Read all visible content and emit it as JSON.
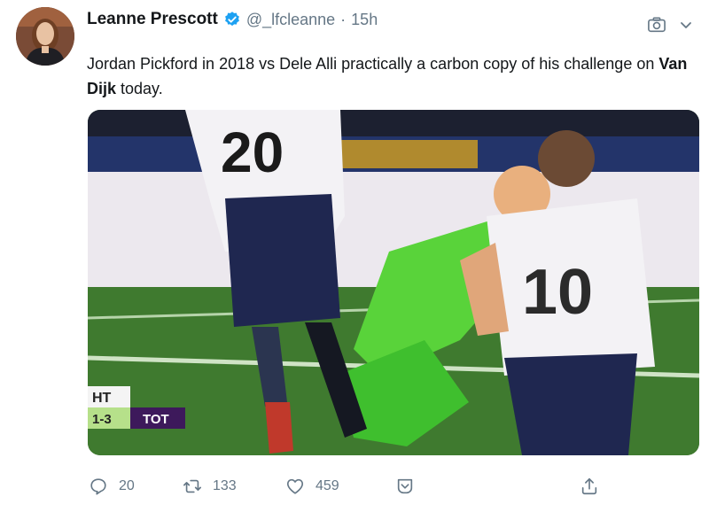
{
  "tweet": {
    "author_name": "Leanne Prescott",
    "handle": "@_lfcleanne",
    "separator": "·",
    "time": "15h",
    "text_before_bold": "Jordan Pickford in 2018 vs Dele Alli practically a carbon copy of his challenge on ",
    "text_bold": "Van Dijk",
    "text_after_bold": " today."
  },
  "media": {
    "scoreboard": {
      "period": "HT",
      "score": "1-3",
      "team": "TOT"
    },
    "player_numbers": [
      "20",
      "10"
    ]
  },
  "actions": {
    "replies": "20",
    "retweets": "133",
    "likes": "459"
  },
  "icons": {
    "verified": "verified-badge-icon",
    "camera": "camera-icon",
    "chevron": "chevron-down-icon",
    "reply": "reply-icon",
    "retweet": "retweet-icon",
    "like": "heart-icon",
    "dm": "direct-message-icon",
    "share": "share-icon"
  },
  "colors": {
    "verified": "#1da1f2",
    "secondary_text": "#657786",
    "scoreboard_team_bg": "#3d195b"
  }
}
